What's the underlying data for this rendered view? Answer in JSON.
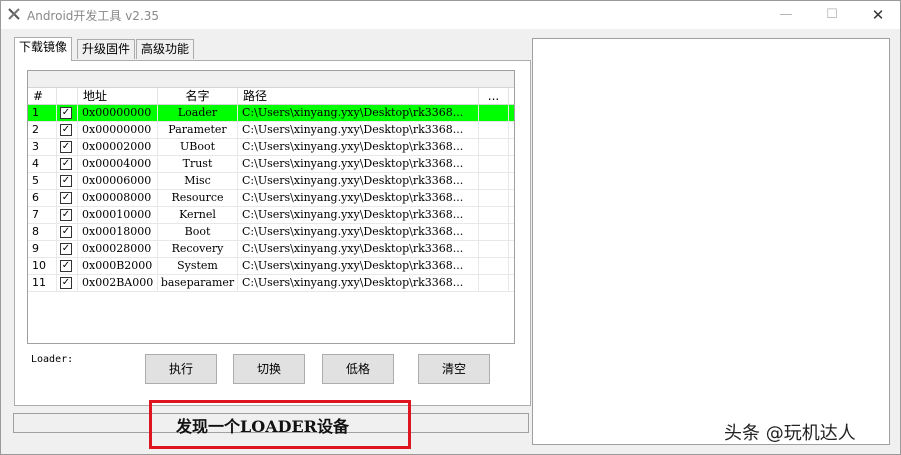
{
  "window": {
    "title": "Android开发工具 v2.35",
    "minimize_glyph": "—",
    "maximize_glyph": "☐",
    "close_glyph": "✕"
  },
  "tabs": [
    {
      "label": "下载镜像",
      "active": true
    },
    {
      "label": "升级固件",
      "active": false
    },
    {
      "label": "高级功能",
      "active": false
    }
  ],
  "table": {
    "columns": [
      "#",
      "",
      "地址",
      "名字",
      "路径",
      "..."
    ],
    "rows": [
      {
        "num": "1",
        "checked": true,
        "address": "0x00000000",
        "name": "Loader",
        "path": "C:\\Users\\xinyang.yxy\\Desktop\\rk3368...",
        "selected": true
      },
      {
        "num": "2",
        "checked": true,
        "address": "0x00000000",
        "name": "Parameter",
        "path": "C:\\Users\\xinyang.yxy\\Desktop\\rk3368..."
      },
      {
        "num": "3",
        "checked": true,
        "address": "0x00002000",
        "name": "UBoot",
        "path": "C:\\Users\\xinyang.yxy\\Desktop\\rk3368..."
      },
      {
        "num": "4",
        "checked": true,
        "address": "0x00004000",
        "name": "Trust",
        "path": "C:\\Users\\xinyang.yxy\\Desktop\\rk3368..."
      },
      {
        "num": "5",
        "checked": true,
        "address": "0x00006000",
        "name": "Misc",
        "path": "C:\\Users\\xinyang.yxy\\Desktop\\rk3368..."
      },
      {
        "num": "6",
        "checked": true,
        "address": "0x00008000",
        "name": "Resource",
        "path": "C:\\Users\\xinyang.yxy\\Desktop\\rk3368..."
      },
      {
        "num": "7",
        "checked": true,
        "address": "0x00010000",
        "name": "Kernel",
        "path": "C:\\Users\\xinyang.yxy\\Desktop\\rk3368..."
      },
      {
        "num": "8",
        "checked": true,
        "address": "0x00018000",
        "name": "Boot",
        "path": "C:\\Users\\xinyang.yxy\\Desktop\\rk3368..."
      },
      {
        "num": "9",
        "checked": true,
        "address": "0x00028000",
        "name": "Recovery",
        "path": "C:\\Users\\xinyang.yxy\\Desktop\\rk3368..."
      },
      {
        "num": "10",
        "checked": true,
        "address": "0x000B2000",
        "name": "System",
        "path": "C:\\Users\\xinyang.yxy\\Desktop\\rk3368..."
      },
      {
        "num": "11",
        "checked": true,
        "address": "0x002BA000",
        "name": "baseparamer",
        "path": "C:\\Users\\xinyang.yxy\\Desktop\\rk3368..."
      }
    ]
  },
  "loader_label": "Loader:",
  "buttons": {
    "run": "执行",
    "switch": "切换",
    "format": "低格",
    "clear": "清空"
  },
  "status": {
    "message": "发现一个LOADER设备"
  },
  "watermark": "头条 @玩机达人",
  "colors": {
    "selected_row": "#00ff00",
    "highlight_border": "#e0141e"
  }
}
